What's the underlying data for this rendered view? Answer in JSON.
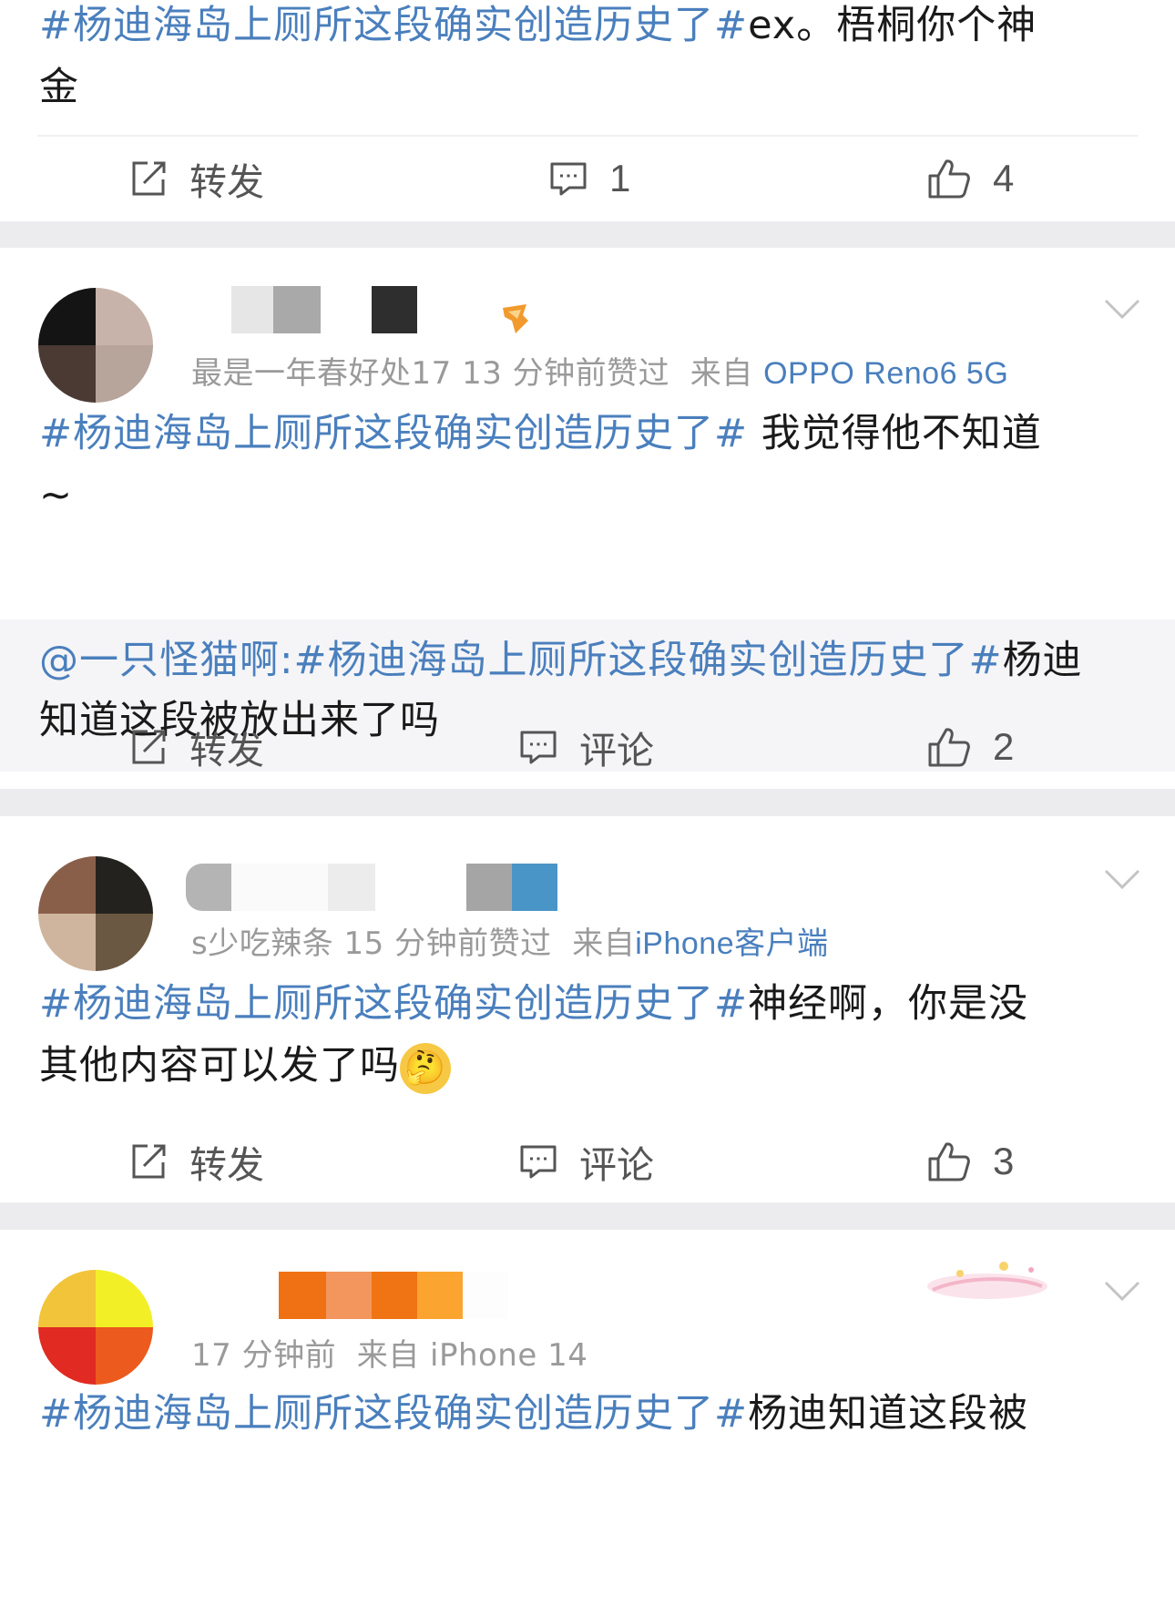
{
  "post1": {
    "text_topic": "#杨迪海岛上厕所这段确实创造历史了#",
    "text_rest_line1": "ex。梧桐你个神",
    "text_rest_line2": "金",
    "actions": {
      "repost": "转发",
      "comment": "1",
      "like": "4"
    }
  },
  "post2": {
    "meta_user": "最是一年春好处17",
    "meta_time": "13 分钟前赞过",
    "meta_from_label": "来自",
    "meta_source": "OPPO Reno6 5G",
    "text_topic": "#杨迪海岛上厕所这段确实创造历史了#",
    "text_rest_line1": " 我觉得他不知道",
    "text_rest_line2": "~",
    "quote_at": "@一只怪猫啊:",
    "quote_topic": "#杨迪海岛上厕所这段确实创造历史了#",
    "quote_rest_line1": "杨迪",
    "quote_rest_line2": "知道这段被放出来了吗",
    "actions": {
      "repost": "转发",
      "comment": "评论",
      "like": "2"
    }
  },
  "post3": {
    "meta_user": "s少吃辣条",
    "meta_time": "15 分钟前赞过",
    "meta_from_label": "来自",
    "meta_source": "iPhone客户端",
    "text_topic": "#杨迪海岛上厕所这段确实创造历史了#",
    "text_rest_line1": "神经啊，你是没",
    "text_rest_line2": "其他内容可以发了吗",
    "emoji": "🤔",
    "actions": {
      "repost": "转发",
      "comment": "评论",
      "like": "3"
    }
  },
  "post4": {
    "meta_time": "17 分钟前",
    "meta_from": "来自 iPhone 14",
    "text_topic": "#杨迪海岛上厕所这段确实创造历史了#",
    "text_rest_line1": "杨迪知道这段被"
  },
  "colors": {
    "accent": "#4a7fbd",
    "background": "#ececee",
    "card": "#ffffff",
    "quote": "#f5f5f7"
  },
  "icons": [
    "repost-icon",
    "comment-icon",
    "like-icon",
    "chevron-down-icon"
  ]
}
